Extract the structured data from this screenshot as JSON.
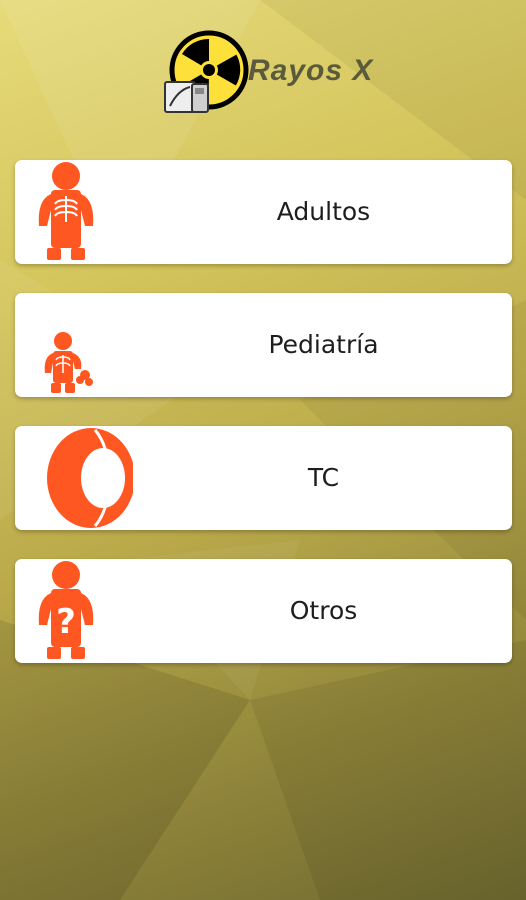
{
  "app": {
    "title": "Rayos X",
    "logo_icon": "radiation-xray-logo-icon",
    "accent": "#ff5722"
  },
  "menu": [
    {
      "label": "Adultos",
      "icon": "adult-xray-icon"
    },
    {
      "label": "Pediatría",
      "icon": "child-xray-icon"
    },
    {
      "label": "TC",
      "icon": "ct-scanner-icon"
    },
    {
      "label": "Otros",
      "icon": "question-figure-icon"
    }
  ]
}
